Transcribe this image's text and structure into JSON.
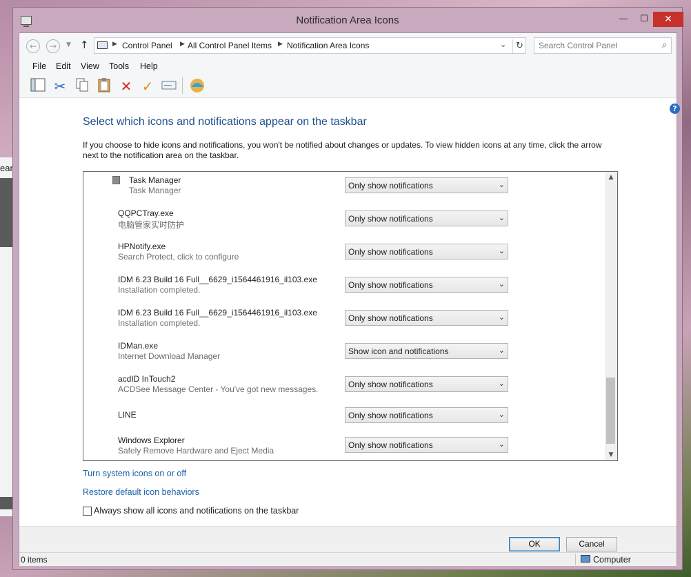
{
  "desktop": {
    "partial_text": "ean"
  },
  "window": {
    "title": "Notification Area Icons",
    "minimize": "—",
    "maximize": "☐",
    "close": "✕"
  },
  "address": {
    "breadcrumbs": [
      "Control Panel",
      "All Control Panel Items",
      "Notification Area Icons"
    ],
    "search_placeholder": "Search Control Panel"
  },
  "menu": [
    "File",
    "Edit",
    "View",
    "Tools",
    "Help"
  ],
  "toolbar_icons": [
    "layout-icon",
    "cut-icon",
    "copy-icon",
    "paste-icon",
    "delete-icon",
    "properties-check-icon",
    "rename-icon",
    "shell-icon"
  ],
  "main": {
    "heading": "Select which icons and notifications appear on the taskbar",
    "description": "If you choose to hide icons and notifications, you won't be notified about changes or updates. To view hidden icons at any time, click the arrow next to the notification area on the taskbar."
  },
  "rows": [
    {
      "name": "Task Manager",
      "sub": "Task Manager",
      "value": "Only show notifications",
      "has_icon": true
    },
    {
      "name": "QQPCTray.exe",
      "sub": "电脑管家实时防护",
      "value": "Only show notifications"
    },
    {
      "name": "HPNotify.exe",
      "sub": "Search Protect, click to configure",
      "value": "Only show notifications"
    },
    {
      "name": "IDM 6.23 Build 16 Full__6629_i1564461916_il103.exe",
      "sub": "Installation completed.",
      "value": "Only show notifications"
    },
    {
      "name": "IDM 6.23 Build 16 Full__6629_i1564461916_il103.exe",
      "sub": "Installation completed.",
      "value": "Only show notifications"
    },
    {
      "name": "IDMan.exe",
      "sub": "Internet Download Manager",
      "value": "Show icon and notifications"
    },
    {
      "name": "acdID InTouch2",
      "sub": " ACDSee Message Center - You've got new messages.",
      "value": "Only show notifications"
    },
    {
      "name": "LINE",
      "sub": "",
      "value": "Only show notifications"
    },
    {
      "name": "Windows Explorer",
      "sub": "Safely Remove Hardware and Eject Media",
      "value": "Only show notifications"
    }
  ],
  "links": {
    "system_icons": "Turn system icons on or off",
    "restore": "Restore default icon behaviors"
  },
  "always_show": {
    "label": "Always show all icons and notifications on the taskbar",
    "checked": false
  },
  "buttons": {
    "ok": "OK",
    "cancel": "Cancel"
  },
  "status": {
    "items": "0 items",
    "location": "Computer"
  },
  "colors": {
    "heading": "#1d4f8c",
    "link": "#1d5fa8",
    "close_button": "#c7312b"
  }
}
